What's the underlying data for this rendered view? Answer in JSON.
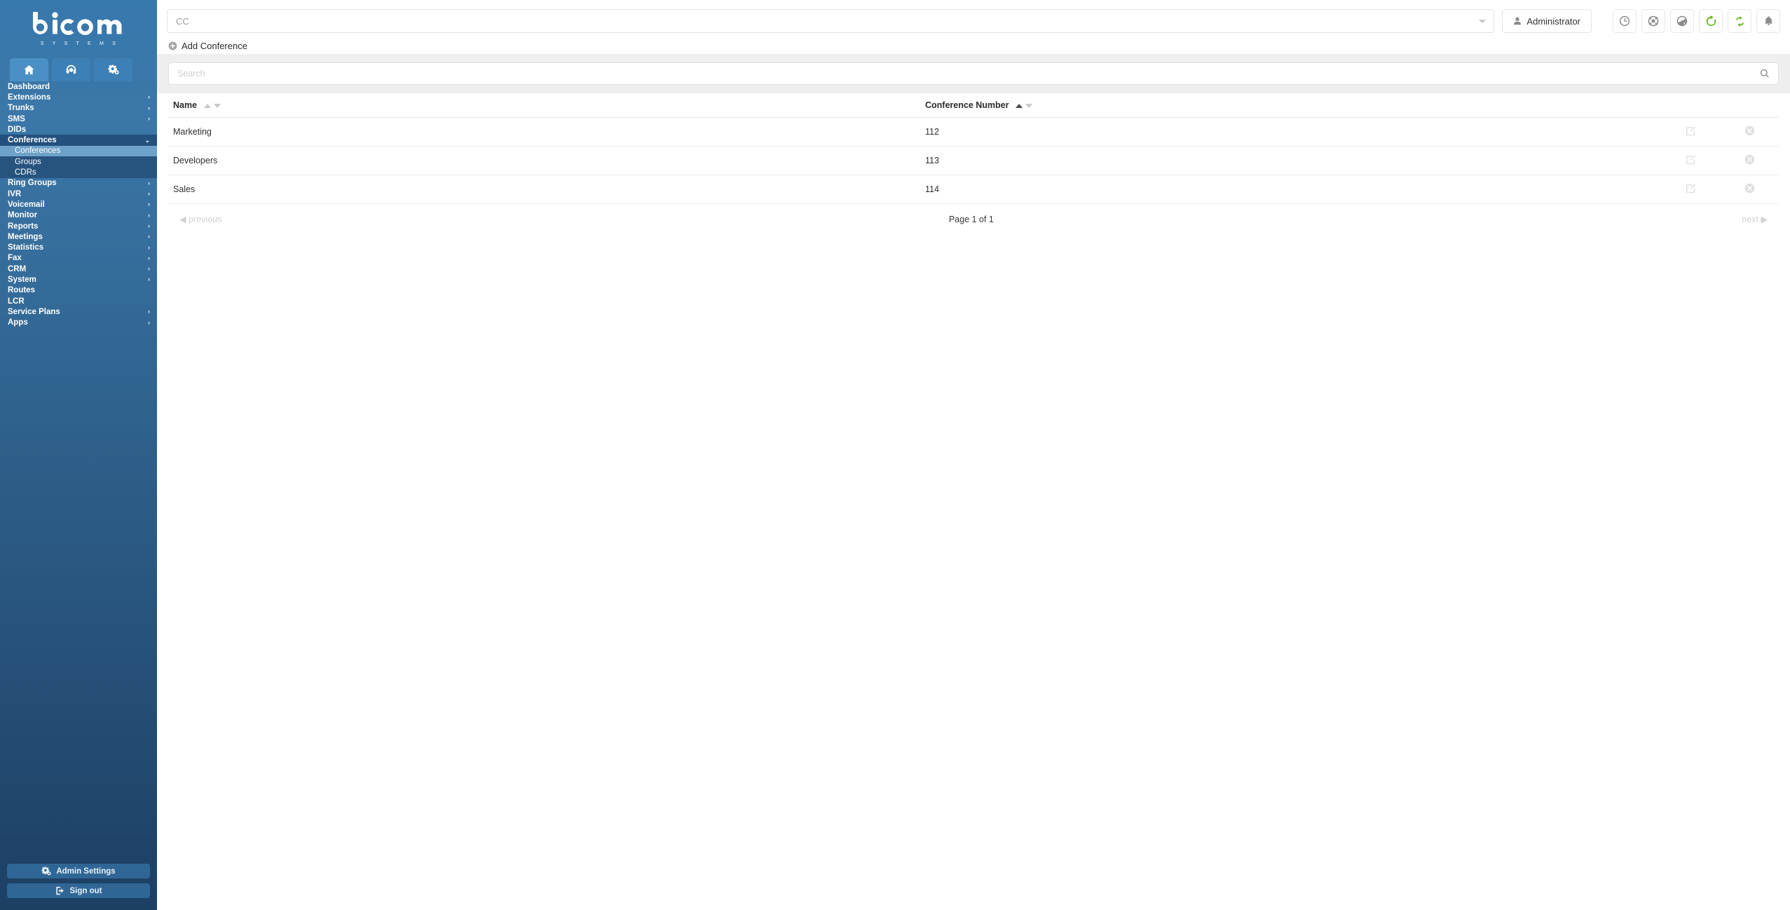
{
  "brand": {
    "logo_text": "bicom",
    "logo_subtitle": "S Y S T E M S"
  },
  "sidebar": {
    "tabs": [
      {
        "name": "home-tab",
        "icon": "home-icon",
        "active": true
      },
      {
        "name": "headset-tab",
        "icon": "headset-icon",
        "active": false
      },
      {
        "name": "settings-tab",
        "icon": "gears-icon",
        "active": false
      }
    ],
    "items": [
      {
        "label": "Dashboard",
        "expandable": false,
        "state": ""
      },
      {
        "label": "Extensions",
        "expandable": true,
        "state": ""
      },
      {
        "label": "Trunks",
        "expandable": true,
        "state": ""
      },
      {
        "label": "SMS",
        "expandable": true,
        "state": ""
      },
      {
        "label": "DIDs",
        "expandable": false,
        "state": ""
      },
      {
        "label": "Conferences",
        "expandable": true,
        "state": "open"
      },
      {
        "label": "Ring Groups",
        "expandable": true,
        "state": ""
      },
      {
        "label": "IVR",
        "expandable": true,
        "state": ""
      },
      {
        "label": "Voicemail",
        "expandable": true,
        "state": ""
      },
      {
        "label": "Monitor",
        "expandable": true,
        "state": ""
      },
      {
        "label": "Reports",
        "expandable": true,
        "state": ""
      },
      {
        "label": "Meetings",
        "expandable": true,
        "state": ""
      },
      {
        "label": "Statistics",
        "expandable": true,
        "state": ""
      },
      {
        "label": "Fax",
        "expandable": true,
        "state": ""
      },
      {
        "label": "CRM",
        "expandable": true,
        "state": ""
      },
      {
        "label": "System",
        "expandable": true,
        "state": ""
      },
      {
        "label": "Routes",
        "expandable": false,
        "state": ""
      },
      {
        "label": "LCR",
        "expandable": false,
        "state": ""
      },
      {
        "label": "Service Plans",
        "expandable": true,
        "state": ""
      },
      {
        "label": "Apps",
        "expandable": true,
        "state": ""
      }
    ],
    "submenu": [
      {
        "label": "Conferences",
        "active": true
      },
      {
        "label": "Groups",
        "active": false
      },
      {
        "label": "CDRs",
        "active": false
      }
    ],
    "expanded_chevron": "⌄",
    "collapsed_chevron": "›",
    "admin_settings_label": "Admin Settings",
    "sign_out_label": "Sign out"
  },
  "topbar": {
    "tenant_select_value": "CC",
    "tenant_select_placeholder": "CC",
    "user_label": "Administrator",
    "icons": [
      {
        "name": "clock-icon",
        "color": "#8c8c8c"
      },
      {
        "name": "lifebuoy-icon",
        "color": "#8c8c8c"
      },
      {
        "name": "globe-icon",
        "color": "#8c8c8c"
      },
      {
        "name": "refresh-icon",
        "color": "#5cb415"
      },
      {
        "name": "sync-icon",
        "color": "#5cb415"
      },
      {
        "name": "bell-icon",
        "color": "#8c8c8c"
      }
    ]
  },
  "page": {
    "add_button_label": "Add Conference",
    "search_placeholder": "Search",
    "search_value": ""
  },
  "table": {
    "columns": [
      {
        "key": "name",
        "label": "Name",
        "sort_asc_active": false,
        "sort_desc_active": false
      },
      {
        "key": "num",
        "label": "Conference Number",
        "sort_asc_active": true,
        "sort_desc_active": false
      }
    ],
    "rows": [
      {
        "name": "Marketing",
        "number": "112"
      },
      {
        "name": "Developers",
        "number": "113"
      },
      {
        "name": "Sales",
        "number": "114"
      }
    ],
    "row_actions": [
      {
        "name": "edit-row-icon",
        "label": "edit"
      },
      {
        "name": "delete-row-icon",
        "label": "delete"
      }
    ]
  },
  "pagination": {
    "previous_label": "previous",
    "page_info": "Page 1 of 1",
    "next_label": "next",
    "previous_arrow": "◀",
    "next_arrow": "▶"
  }
}
